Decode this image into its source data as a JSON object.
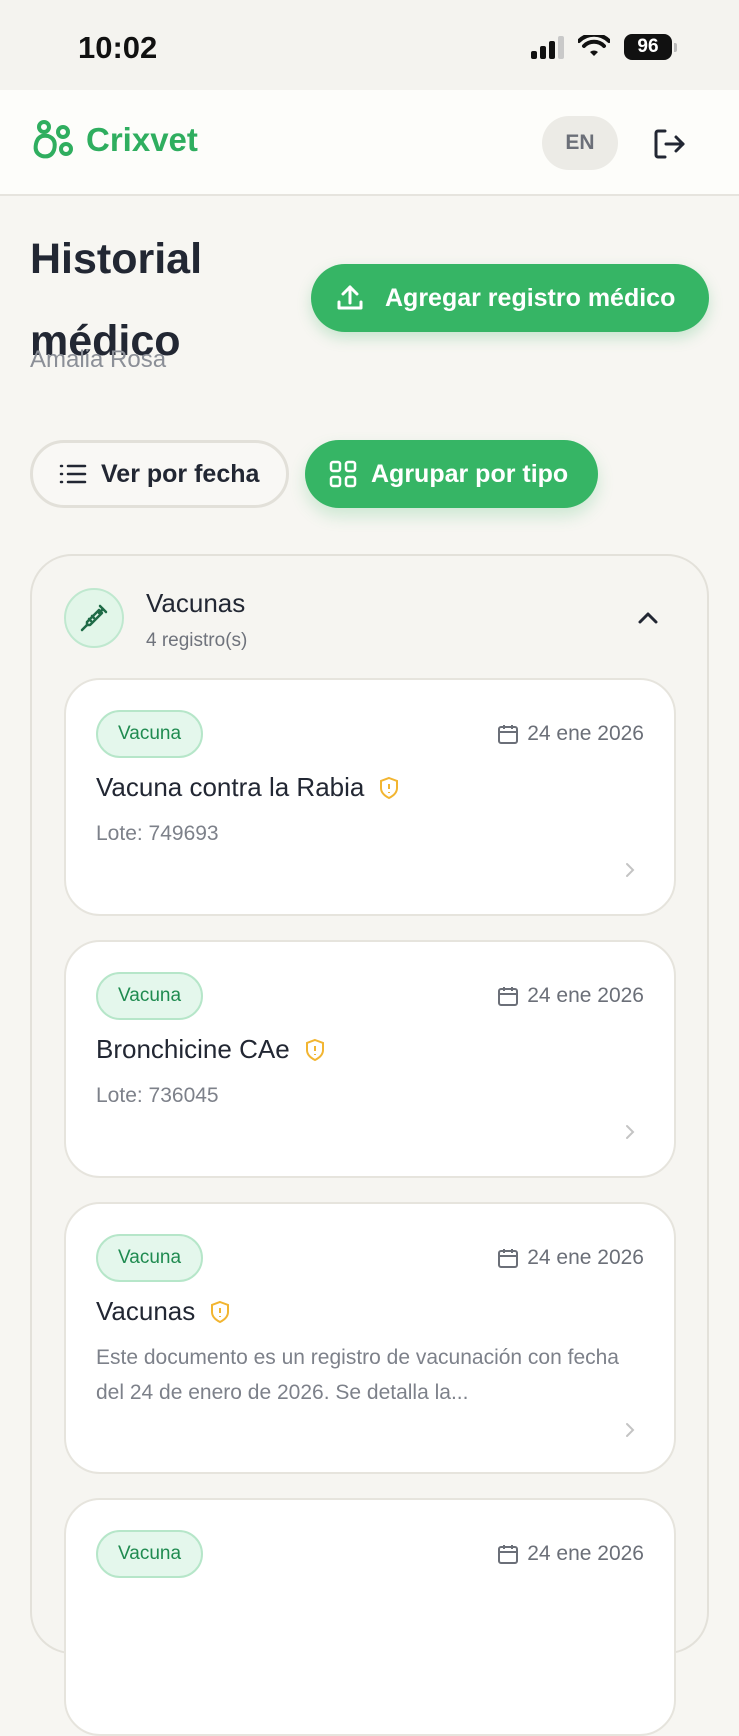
{
  "status_bar": {
    "time": "10:02",
    "battery": "96"
  },
  "header": {
    "brand": "Crixvet",
    "lang": "EN"
  },
  "page": {
    "title": "Historial médico",
    "subtitle": "Amalia Rosa",
    "add_button": "Agregar registro médico"
  },
  "view_toggle": {
    "by_date": "Ver por fecha",
    "by_type": "Agrupar por tipo"
  },
  "group": {
    "title": "Vacunas",
    "count": "4 registro(s)",
    "records": [
      {
        "badge": "Vacuna",
        "date": "24 ene 2026",
        "title": "Vacuna contra la Rabia",
        "detail": "Lote: 749693"
      },
      {
        "badge": "Vacuna",
        "date": "24 ene 2026",
        "title": "Bronchicine CAe",
        "detail": "Lote: 736045"
      },
      {
        "badge": "Vacuna",
        "date": "24 ene 2026",
        "title": "Vacunas",
        "detail": "Este documento es un registro de vacunación con fecha del 24 de enero de 2026. Se detalla la..."
      },
      {
        "badge": "Vacuna",
        "date": "24 ene 2026",
        "title": "",
        "detail": ""
      }
    ]
  },
  "colors": {
    "brand": "#2fae5f",
    "primary_button": "#36b565",
    "badge_bg": "#e4f7ec",
    "warning_icon": "#f2b531"
  }
}
